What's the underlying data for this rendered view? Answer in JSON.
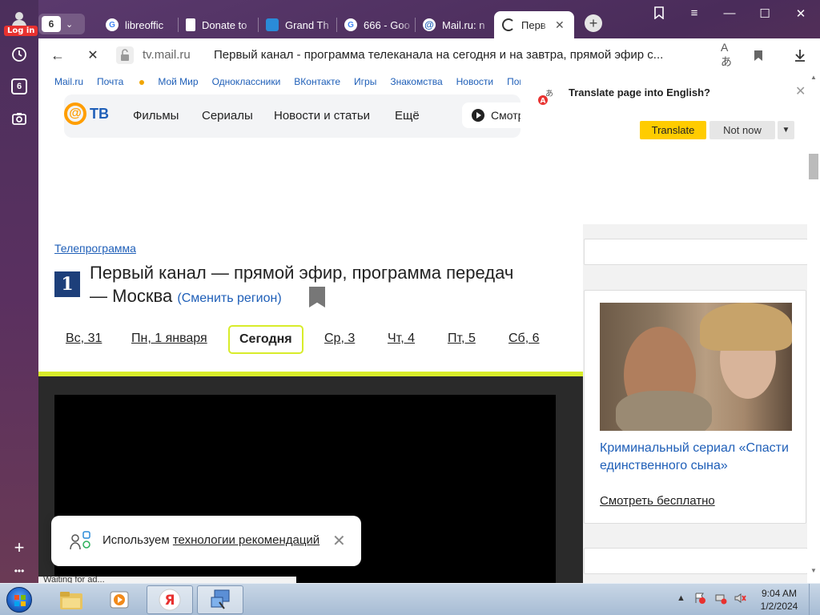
{
  "rail": {
    "login_badge": "Log in",
    "tab_count": "6"
  },
  "tabs": [
    {
      "title": "libreoffic",
      "icon": "google-icon"
    },
    {
      "title": "Donate to",
      "icon": "document-icon"
    },
    {
      "title": "Grand Th",
      "icon": "app-icon"
    },
    {
      "title": "666 - Goo",
      "icon": "google-icon"
    },
    {
      "title": "Mail.ru: n",
      "icon": "mailru-icon"
    },
    {
      "title": "Перв",
      "icon": "loading-icon",
      "active": true
    }
  ],
  "tab_count": "6",
  "address": {
    "domain": "tv.mail.ru",
    "title": "Первый канал - программа телеканала на сегодня и на завтра, прямой эфир с..."
  },
  "mailnav": [
    "Mail.ru",
    "Почта",
    "Мой Мир",
    "Одноклассники",
    "ВКонтакте",
    "Игры",
    "Знакомства",
    "Новости",
    "Поис"
  ],
  "tvheader": {
    "logo": "ТВ",
    "menu": [
      "Фильмы",
      "Сериалы",
      "Новости и статьи",
      "Ещё"
    ],
    "watch": "Смотр"
  },
  "breadcrumb": "Телепрограмма",
  "heading": {
    "line1": "Первый канал — прямой эфир, программа передач",
    "line2": "— Москва",
    "region": "(Сменить регион)"
  },
  "days": [
    "Вс, 31",
    "Пн, 1 января",
    "Сегодня",
    "Ср, 3",
    "Чт, 4",
    "Пт, 5",
    "Сб, 6"
  ],
  "promo": {
    "title": "Криминальный сериал «Спасти единственного сына»",
    "link": "Смотреть бесплатно"
  },
  "cookie": {
    "text": "Используем ",
    "link": "технологии рекомендаций"
  },
  "translate": {
    "question": "Translate page into English?",
    "translate_btn": "Translate",
    "notnow_btn": "Not now"
  },
  "status_text": "Waiting for ad...",
  "clock": {
    "time": "9:04 AM",
    "date": "1/2/2024"
  },
  "colors": {
    "accent_yellow": "#ffcc00",
    "link_blue": "#1f5fb8",
    "schedule_yellow": "#d8ec2a"
  }
}
